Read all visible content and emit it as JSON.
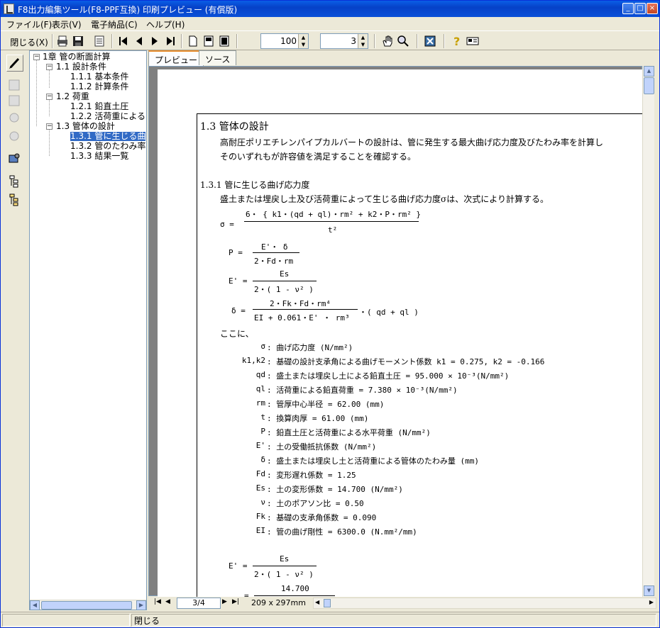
{
  "window": {
    "title": "F8出力編集ツール(F8-PPF互換) 印刷プレビュー (有償版)"
  },
  "menu": [
    "ファイル(F)",
    "表示(V)",
    "電子納品(C)",
    "ヘルプ(H)"
  ],
  "toolbar": {
    "close_label": "閉じる(X)",
    "zoom_value": "100",
    "page_count": "3"
  },
  "tree": {
    "items": [
      {
        "label": "1章 管の断面計算"
      },
      {
        "label": "1.1 設計条件"
      },
      {
        "label": "1.1.1 基本条件"
      },
      {
        "label": "1.1.2 計算条件"
      },
      {
        "label": "1.2 荷重"
      },
      {
        "label": "1.2.1 鉛直土圧"
      },
      {
        "label": "1.2.2 活荷重による"
      },
      {
        "label": "1.3 管体の設計"
      },
      {
        "label": "1.3.1 管に生じる曲"
      },
      {
        "label": "1.3.2 管のたわみ率"
      },
      {
        "label": "1.3.3 結果一覧"
      }
    ]
  },
  "tabs": [
    "プレビュー",
    "ソース"
  ],
  "doc": {
    "h1": "1.3 管体の設計",
    "p1": "高耐圧ポリエチレンパイプカルバートの設計は、管に発生する最大曲げ応力度及びたわみ率を計算し",
    "p2": "そのいずれもが許容値を満足することを確認する。",
    "h2": "1.3.1 管に生じる曲げ応力度",
    "p3": "盛土または埋戻し土及び活荷重によって生じる曲げ応力度σは、次式により計算する。",
    "f1_lhs": "σ =",
    "f1_num": "6・ { k1・(qd + ql)・rm² + k2・P・rm² }",
    "f1_den": "t²",
    "f2_lhs": "P =",
    "f2_num": "E'・ δ",
    "f2_den": "2・Fd・rm",
    "f3_lhs": "E' =",
    "f3_num": "Es",
    "f3_den": "2・( 1 - ν² )",
    "f4_lhs": "δ =",
    "f4_num": "2・Fk・Fd・rm⁴",
    "f4_den": "EI + 0.061・E' ・ rm³",
    "f4_rhs": "・( qd + ql )",
    "koko": "ここに、",
    "defs": [
      {
        "sym": "σ",
        "text": ": 曲げ応力度 (N/mm²)"
      },
      {
        "sym": "k1,k2",
        "text": ": 基礎の設計支承角による曲げモーメント係数  k1 = 0.275, k2 = -0.166"
      },
      {
        "sym": "qd",
        "text": ": 盛土または埋戻し土による鉛直土圧 = 95.000 × 10⁻³(N/mm²)"
      },
      {
        "sym": "ql",
        "text": ": 活荷重による鉛直荷重 = 7.380 × 10⁻³(N/mm²)"
      },
      {
        "sym": "rm",
        "text": ": 管厚中心半径 = 62.00 (mm)"
      },
      {
        "sym": "t",
        "text": ": 換算肉厚 = 61.00 (mm)"
      },
      {
        "sym": "P",
        "text": ": 鉛直土圧と活荷重による水平荷重 (N/mm²)"
      },
      {
        "sym": "E'",
        "text": ": 土の受働抵抗係数 (N/mm²)"
      },
      {
        "sym": "δ",
        "text": ": 盛土または埋戻し土と活荷重による管体のたわみ量 (mm)"
      },
      {
        "sym": "Fd",
        "text": ": 変形遅れ係数 = 1.25"
      },
      {
        "sym": "Es",
        "text": ": 土の変形係数 = 14.700 (N/mm²)"
      },
      {
        "sym": "ν",
        "text": ": 土のポアソン比 = 0.50"
      },
      {
        "sym": "Fk",
        "text": ": 基礎の支承角係数 = 0.090"
      },
      {
        "sym": "EI",
        "text": ": 管の曲げ剛性 = 6300.0 (N.mm²/mm)"
      }
    ],
    "f5_lhs": "E' =",
    "f5_num": "Es",
    "f5_den": "2・( 1 - ν² )",
    "f6_eq": "=",
    "f6_num": "14.700"
  },
  "nav": {
    "page": "3/4",
    "size": "209 x 297mm"
  },
  "status": {
    "text": "閉じる"
  }
}
